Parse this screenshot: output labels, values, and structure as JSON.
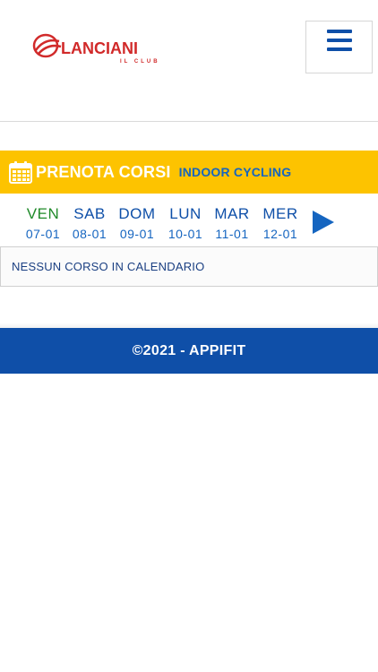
{
  "header": {
    "logo_text": "LANCIANI",
    "logo_subtext": "IL CLUB",
    "menu_icon": "hamburger-menu-icon"
  },
  "booking": {
    "icon": "calendar-icon",
    "title": "PRENOTA CORSI",
    "subtitle": "INDOOR CYCLING"
  },
  "days": [
    {
      "name": "VEN",
      "date": "07-01",
      "active": true
    },
    {
      "name": "SAB",
      "date": "08-01",
      "active": false
    },
    {
      "name": "DOM",
      "date": "09-01",
      "active": false
    },
    {
      "name": "LUN",
      "date": "10-01",
      "active": false
    },
    {
      "name": "MAR",
      "date": "11-01",
      "active": false
    },
    {
      "name": "MER",
      "date": "12-01",
      "active": false
    }
  ],
  "next_icon": "play-arrow-icon",
  "message": "NESSUN CORSO IN CALENDARIO",
  "footer": {
    "text": "©2021 - APPIFIT"
  },
  "colors": {
    "brand_blue": "#0f4fa8",
    "accent_yellow": "#fdc300",
    "active_day_green": "#208a2a",
    "logo_red": "#d12a2a"
  }
}
